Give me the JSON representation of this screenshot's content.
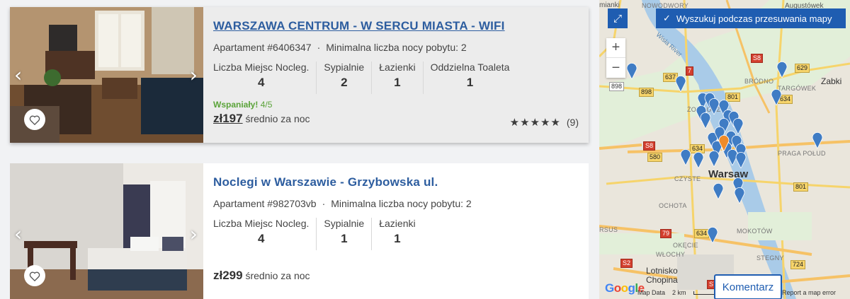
{
  "listings": [
    {
      "title": "WARSZAWA CENTRUM - W SERCU MIASTA - WIFI",
      "apartment": "Apartament #6406347",
      "separator": "·",
      "min_nights": "Minimalna liczba nocy pobytu: 2",
      "stats": [
        {
          "label": "Liczba Miejsc Nocleg.",
          "value": "4"
        },
        {
          "label": "Sypialnie",
          "value": "2"
        },
        {
          "label": "Łazienki",
          "value": "1"
        },
        {
          "label": "Oddzielna Toaleta",
          "value": "1"
        }
      ],
      "rating_label": "Wspaniały!",
      "rating_score": "4/5",
      "price": "zł197",
      "price_suffix": "średnio za noc",
      "stars": "★★★★★",
      "review_count": "(9)"
    },
    {
      "title": "Noclegi w Warszawie - Grzybowska ul.",
      "apartment": "Apartament #982703vb",
      "separator": "·",
      "min_nights": "Minimalna liczba nocy pobytu: 2",
      "stats": [
        {
          "label": "Liczba Miejsc Nocleg.",
          "value": "4"
        },
        {
          "label": "Sypialnie",
          "value": "1"
        },
        {
          "label": "Łazienki",
          "value": "1"
        }
      ],
      "price": "zł299",
      "price_suffix": "średnio za noc"
    }
  ],
  "icons": {
    "prev": "‹",
    "next": "›",
    "heart": "heart-icon",
    "expand": "⤢",
    "check": "✓"
  },
  "map": {
    "search_toggle": "Wyszukuj podczas przesuwania mapy",
    "zoom_in": "+",
    "zoom_out": "−",
    "city": "Warsaw",
    "labels": {
      "nowodwory": "NOWODWORY",
      "mianki": "mianki",
      "augustowek": "Augustówek",
      "zabki": "Zabki",
      "brodno": "BRÓDNO",
      "targowek": "TARGÓWEK",
      "zoliborz": "ŻOLIBORZ",
      "praga": "PRAGA POŁUD",
      "czyste": "CZYSTE",
      "ochota": "OCHOTA",
      "mokotow": "MOKOTÓW",
      "ursus": "RSUS",
      "okecie": "OKĘCIE",
      "wlochy": "WŁOCHY",
      "stegny": "STEGNY",
      "airport_1": "Lotnisko",
      "airport_2": "Chopina",
      "river": "Wisła River"
    },
    "roads": {
      "r898a": "898",
      "r898b": "898",
      "r637": "637",
      "r7": "7",
      "r801a": "801",
      "r801b": "801",
      "r629": "629",
      "r634a": "634",
      "r634b": "634",
      "r634c": "634",
      "rs8a": "S8",
      "rs8b": "S8",
      "r580": "580",
      "r79": "79",
      "rs2": "S2",
      "r724": "724",
      "rs79": "S79"
    },
    "google": "Google",
    "map_data": "Map Data",
    "scale": "2 km",
    "report": "Report a map error",
    "komentarz": "Komentarz",
    "colors": {
      "pin": "#3f7cc4",
      "pin_active": "#ef8b2a",
      "accent": "#1f5db1"
    }
  }
}
